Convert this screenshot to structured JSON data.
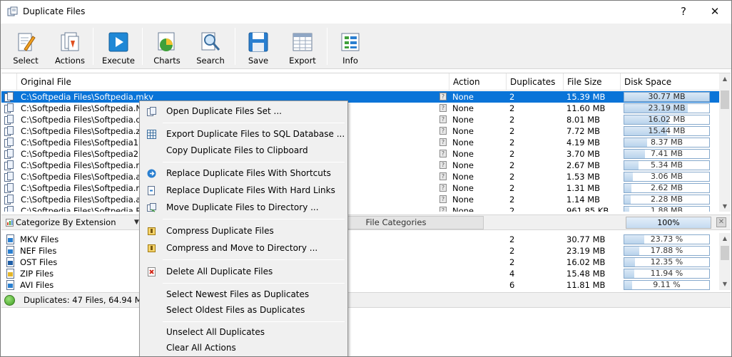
{
  "window": {
    "title": "Duplicate Files",
    "help": "?",
    "close": "✕"
  },
  "toolbar": {
    "select": "Select",
    "actions": "Actions",
    "execute": "Execute",
    "charts": "Charts",
    "search": "Search",
    "save": "Save",
    "export": "Export",
    "info": "Info"
  },
  "columns": {
    "original": "Original File",
    "action": "Action",
    "duplicates": "Duplicates",
    "size": "File Size",
    "disk": "Disk Space"
  },
  "files": [
    {
      "name": "C:\\Softpedia Files\\Softpedia.mkv",
      "action": "None",
      "dups": "2",
      "size": "15.39 MB",
      "disk": "30.77 MB",
      "pct": 100,
      "selected": true
    },
    {
      "name": "C:\\Softpedia Files\\Softpedia.NEF",
      "action": "None",
      "dups": "2",
      "size": "11.60 MB",
      "disk": "23.19 MB",
      "pct": 75,
      "selected": false
    },
    {
      "name": "C:\\Softpedia Files\\Softpedia.ost",
      "action": "None",
      "dups": "2",
      "size": "8.01 MB",
      "disk": "16.02 MB",
      "pct": 52,
      "selected": false
    },
    {
      "name": "C:\\Softpedia Files\\Softpedia.zip",
      "action": "None",
      "dups": "2",
      "size": "7.72 MB",
      "disk": "15.44 MB",
      "pct": 50,
      "selected": false
    },
    {
      "name": "C:\\Softpedia Files\\Softpedia1.EXE",
      "action": "None",
      "dups": "2",
      "size": "4.19 MB",
      "disk": "8.37 MB",
      "pct": 27,
      "selected": false
    },
    {
      "name": "C:\\Softpedia Files\\Softpedia2.avi",
      "action": "None",
      "dups": "2",
      "size": "3.70 MB",
      "disk": "7.41 MB",
      "pct": 24,
      "selected": false
    },
    {
      "name": "C:\\Softpedia Files\\Softpedia.rar",
      "action": "None",
      "dups": "2",
      "size": "2.67 MB",
      "disk": "5.34 MB",
      "pct": 17,
      "selected": false
    },
    {
      "name": "C:\\Softpedia Files\\Softpedia.avi",
      "action": "None",
      "dups": "2",
      "size": "1.53 MB",
      "disk": "3.06 MB",
      "pct": 10,
      "selected": false
    },
    {
      "name": "C:\\Softpedia Files\\Softpedia.rtf",
      "action": "None",
      "dups": "2",
      "size": "1.31 MB",
      "disk": "2.62 MB",
      "pct": 8.5,
      "selected": false
    },
    {
      "name": "C:\\Softpedia Files\\Softpedia.aac",
      "action": "None",
      "dups": "2",
      "size": "1.14 MB",
      "disk": "2.28 MB",
      "pct": 7.4,
      "selected": false
    },
    {
      "name": "C:\\Softpedia Files\\Softpedia.Rec",
      "action": "None",
      "dups": "2",
      "size": "961.85 KB",
      "disk": "1.88 MB",
      "pct": 6.1,
      "selected": false
    }
  ],
  "midbar": {
    "category": "Categorize By Extension",
    "tab": "File Categories",
    "progress": "100%",
    "progress_pct": 100
  },
  "categories": [
    {
      "name": "MKV Files",
      "dups": "2",
      "size": "30.77 MB",
      "pct_text": "23.73 %",
      "pct": 23.73
    },
    {
      "name": "NEF Files",
      "dups": "2",
      "size": "23.19 MB",
      "pct_text": "17.88 %",
      "pct": 17.88
    },
    {
      "name": "OST Files",
      "dups": "2",
      "size": "16.02 MB",
      "pct_text": "12.35 %",
      "pct": 12.35
    },
    {
      "name": "ZIP Files",
      "dups": "4",
      "size": "15.48 MB",
      "pct_text": "11.94 %",
      "pct": 11.94
    },
    {
      "name": "AVI Files",
      "dups": "6",
      "size": "11.81 MB",
      "pct_text": "9.11 %",
      "pct": 9.11
    }
  ],
  "status": {
    "text": "Duplicates: 47 Files, 64.94 MB"
  },
  "menu": {
    "open_set": "Open Duplicate Files Set ...",
    "export_sql": "Export Duplicate Files to SQL Database ...",
    "copy_clipboard": "Copy Duplicate Files to Clipboard",
    "replace_shortcuts": "Replace Duplicate Files With Shortcuts",
    "replace_hardlinks": "Replace Duplicate Files With Hard Links",
    "move_dir": "Move Duplicate Files to Directory ...",
    "compress": "Compress Duplicate Files",
    "compress_move": "Compress and Move to Directory ...",
    "delete_all": "Delete All Duplicate Files",
    "select_newest": "Select Newest Files as Duplicates",
    "select_oldest": "Select Oldest Files as Duplicates",
    "unselect_all": "Unselect All Duplicates",
    "clear_actions": "Clear All Actions"
  },
  "colors": {
    "selection": "#0a74d8",
    "bar_border": "#86a9cc",
    "bar_fill": "#c4dbf0"
  }
}
